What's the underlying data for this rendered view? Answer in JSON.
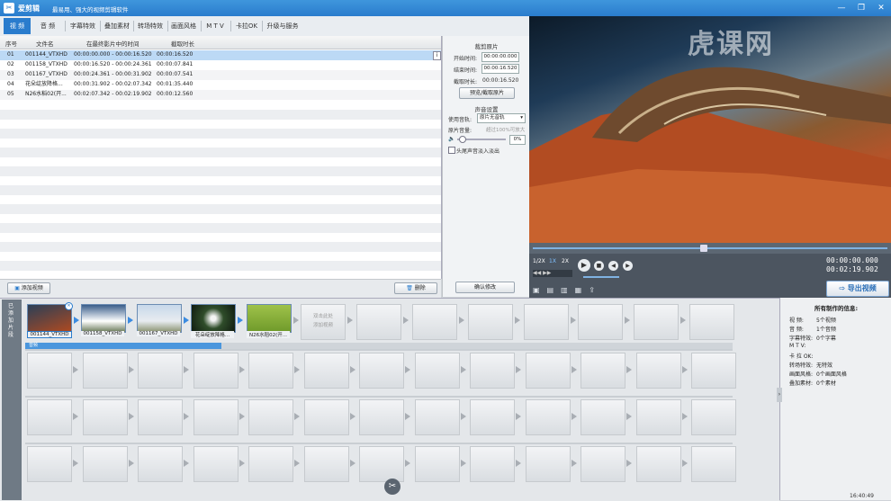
{
  "app": {
    "name": "爱剪辑",
    "slogan": "最易用、强大的视频剪辑软件"
  },
  "tabs": [
    {
      "label": "视  频",
      "active": true
    },
    {
      "label": "音  频"
    },
    {
      "label": "字幕特效"
    },
    {
      "label": "叠加素材"
    },
    {
      "label": "转场特效"
    },
    {
      "label": "画面风格"
    },
    {
      "label": "M T V"
    },
    {
      "label": "卡拉OK"
    },
    {
      "label": "升级与服务"
    }
  ],
  "cliplist": {
    "headers": [
      "序号",
      "文件名",
      "在最终影片中的时间",
      "截取时长"
    ],
    "rows": [
      {
        "no": "01",
        "name": "001144_VTXHD",
        "time": "00:00:00.000 - 00:00:16.520",
        "dur": "00:00:16.520"
      },
      {
        "no": "02",
        "name": "001158_VTXHD",
        "time": "00:00:16.520 - 00:00:24.361",
        "dur": "00:00:07.841"
      },
      {
        "no": "03",
        "name": "001167_VTXHD",
        "time": "00:00:24.361 - 00:00:31.902",
        "dur": "00:00:07.541"
      },
      {
        "no": "04",
        "name": "花朵绽放降格...",
        "time": "00:00:31.902 - 00:02:07.342",
        "dur": "00:01:35.440"
      },
      {
        "no": "05",
        "name": "N26水稻02(开...",
        "time": "00:02:07.342 - 00:02:19.902",
        "dur": "00:00:12.560"
      }
    ],
    "add_label": "添加视频",
    "delete_label": "删除"
  },
  "settings": {
    "section1": "裁剪原片",
    "start_label": "开始时间:",
    "start_value": "00:00:00.000",
    "end_label": "结束时间:",
    "end_value": "00:00:16.520",
    "dur_label": "截取时长:",
    "dur_value": "00:00:16.520",
    "preview_btn": "预览/截取原片",
    "section2": "声音设置",
    "track_label": "使用音轨:",
    "track_value": "原片无音轨",
    "volume_label": "原片音量:",
    "volume_hint": "超过100%可放大",
    "volume_value": "0%",
    "fade_label": "头尾声音淡入淡出",
    "confirm_btn": "确认修改"
  },
  "player": {
    "speeds": [
      "1/2X",
      "1X",
      "2X"
    ],
    "current_time": "00:00:00.000",
    "total_time": "00:02:19.902",
    "export_label": "导出视频"
  },
  "watermark": "虎课网",
  "timeline": {
    "side_label": "已添加片段",
    "clips": [
      "001144_VTXHD",
      "001158_VTXHD",
      "001167_VTXHD",
      "花朵绽放降格...",
      "N26水稻02(开..."
    ],
    "drop_hint": "双击此处\n添加视频",
    "audio_tag": "音频"
  },
  "info": {
    "title": "所有制作的信息:",
    "rows": [
      {
        "k": "视    频:",
        "v": "5个视频"
      },
      {
        "k": "音    频:",
        "v": "1个音频"
      },
      {
        "k": "字幕特效:",
        "v": "0个字幕"
      },
      {
        "k": "M  T  V:",
        "v": ""
      },
      {
        "k": "卡 拉 OK:",
        "v": ""
      },
      {
        "k": "转场特效:",
        "v": "无特效"
      },
      {
        "k": "画面风格:",
        "v": "0个画面风格"
      },
      {
        "k": "叠加素材:",
        "v": "0个素材"
      }
    ]
  },
  "taskbar": {
    "clock": "16:40:49"
  }
}
